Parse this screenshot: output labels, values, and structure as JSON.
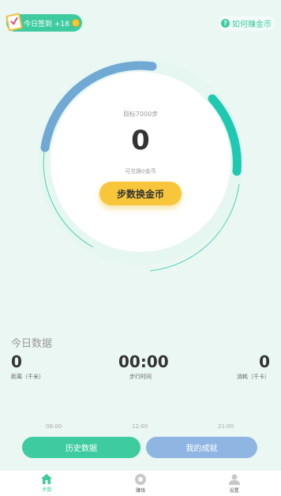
{
  "header": {
    "checkin_label": "今日签到 +18",
    "howto_label": "如何赚金币"
  },
  "dial": {
    "goal_text": "目标7000步",
    "steps": "0",
    "exchangeable_text": "可兑换0金币",
    "exchange_button": "步数换金币"
  },
  "today": {
    "title": "今日数据",
    "distance_value": "0",
    "distance_label": "距离（千米）",
    "time_value": "00:00",
    "time_label": "步行时间",
    "calorie_value": "0",
    "calorie_label": "消耗（千卡）"
  },
  "time_axis": [
    "06:00",
    "12:00",
    "21:00"
  ],
  "buttons": {
    "history": "历史数据",
    "achievement": "我的成就"
  },
  "tabbar": [
    {
      "label": "步数",
      "icon": "home-icon",
      "active": true
    },
    {
      "label": "赚钱",
      "icon": "coin-icon",
      "active": false
    },
    {
      "label": "设置",
      "icon": "user-icon",
      "active": false
    }
  ],
  "colors": {
    "accent": "#3ecba0",
    "arc_blue": "#6fa9d4",
    "arc_teal": "#1ec9b2",
    "button_yellow": "#f7c63a",
    "button_blue": "#8fb6e3"
  }
}
